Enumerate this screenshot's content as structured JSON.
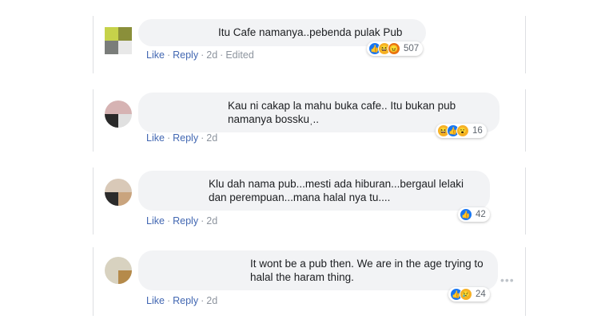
{
  "comments": [
    {
      "text": "Itu Cafe namanya..pebenda pulak Pub",
      "like": "Like",
      "reply": "Reply",
      "time": "2d",
      "edited": "Edited",
      "reaction_count": "507"
    },
    {
      "text": "Kau ni cakap la mahu buka cafe.. Itu bukan pub namanya bosskuˌ..",
      "like": "Like",
      "reply": "Reply",
      "time": "2d",
      "reaction_count": "16"
    },
    {
      "text": "Klu dah nama pub...mesti ada hiburan...bergaul lelaki dan perempuan...mana halal nya tu....",
      "like": "Like",
      "reply": "Reply",
      "time": "2d",
      "reaction_count": "42"
    },
    {
      "text": "It wont be a pub then. We are in the age trying to halal the haram thing.",
      "like": "Like",
      "reply": "Reply",
      "time": "2d",
      "reaction_count": "24"
    }
  ],
  "more_label": "•••",
  "colors": {
    "link": "#4267b2",
    "bubble": "#f2f3f5",
    "meta": "#8d949e"
  }
}
